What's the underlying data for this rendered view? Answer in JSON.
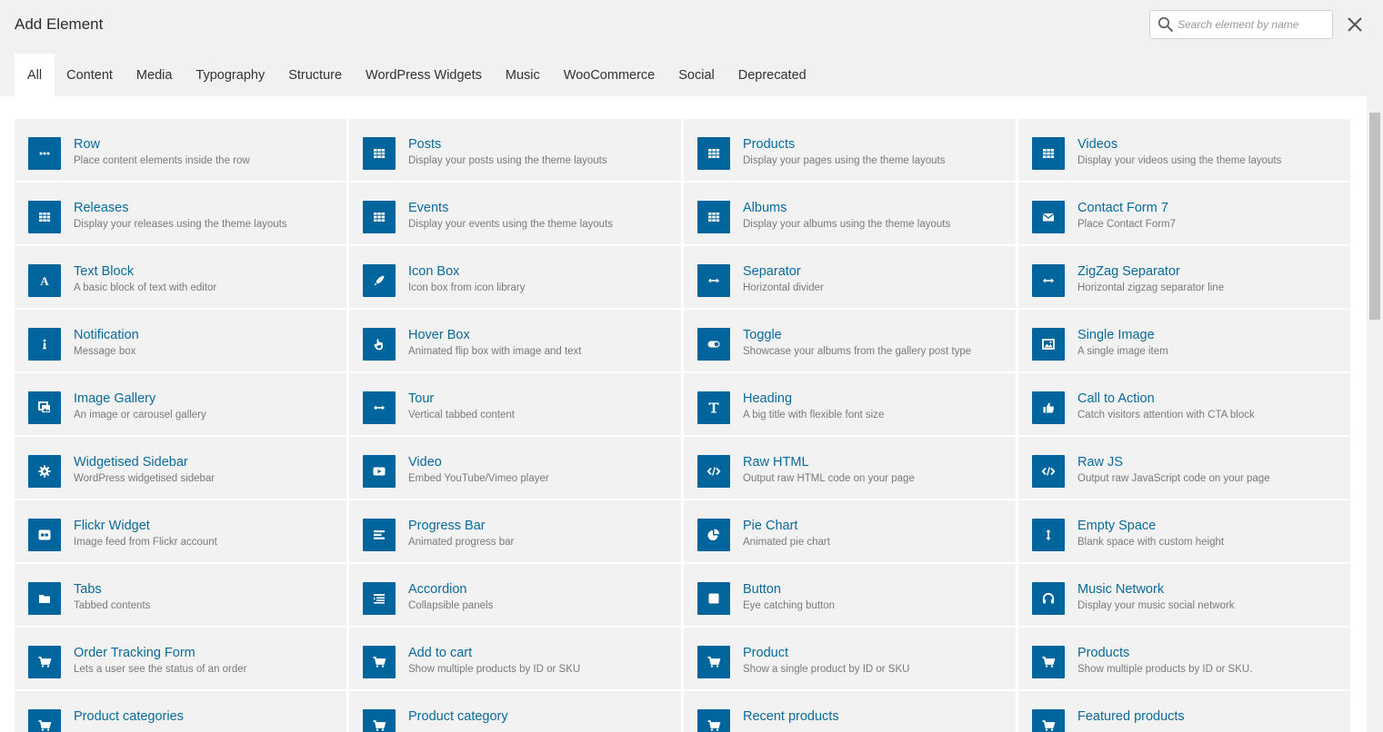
{
  "dialog": {
    "title": "Add Element",
    "search_placeholder": "Search element by name",
    "search_value": ""
  },
  "tabs": [
    {
      "label": "All",
      "active": true
    },
    {
      "label": "Content"
    },
    {
      "label": "Media"
    },
    {
      "label": "Typography"
    },
    {
      "label": "Structure"
    },
    {
      "label": "WordPress Widgets"
    },
    {
      "label": "Music"
    },
    {
      "label": "WooCommerce"
    },
    {
      "label": "Social"
    },
    {
      "label": "Deprecated"
    }
  ],
  "colors": {
    "accent": "#00659c",
    "link": "#0a6a9c"
  },
  "elements": [
    {
      "name": "Row",
      "desc": "Place content elements inside the row",
      "icon": "dots-icon"
    },
    {
      "name": "Posts",
      "desc": "Display your posts using the theme layouts",
      "icon": "grid-icon"
    },
    {
      "name": "Products",
      "desc": "Display your pages using the theme layouts",
      "icon": "grid-icon"
    },
    {
      "name": "Videos",
      "desc": "Display your videos using the theme layouts",
      "icon": "grid-icon"
    },
    {
      "name": "Releases",
      "desc": "Display your releases using the theme layouts",
      "icon": "grid-icon"
    },
    {
      "name": "Events",
      "desc": "Display your events using the theme layouts",
      "icon": "grid-icon"
    },
    {
      "name": "Albums",
      "desc": "Display your albums using the theme layouts",
      "icon": "grid-icon"
    },
    {
      "name": "Contact Form 7",
      "desc": "Place Contact Form7",
      "icon": "envelope-icon"
    },
    {
      "name": "Text Block",
      "desc": "A basic block of text with editor",
      "icon": "letter-a-icon"
    },
    {
      "name": "Icon Box",
      "desc": "Icon box from icon library",
      "icon": "rocket-icon"
    },
    {
      "name": "Separator",
      "desc": "Horizontal divider",
      "icon": "arrows-horizontal-icon"
    },
    {
      "name": "ZigZag Separator",
      "desc": "Horizontal zigzag separator line",
      "icon": "arrows-horizontal-icon"
    },
    {
      "name": "Notification",
      "desc": "Message box",
      "icon": "info-icon"
    },
    {
      "name": "Hover Box",
      "desc": "Animated flip box with image and text",
      "icon": "pointer-hand-icon"
    },
    {
      "name": "Toggle",
      "desc": "Showcase your albums from the gallery post type",
      "icon": "toggle-icon"
    },
    {
      "name": "Single Image",
      "desc": "A single image item",
      "icon": "picture-icon"
    },
    {
      "name": "Image Gallery",
      "desc": "An image or carousel gallery",
      "icon": "gallery-icon"
    },
    {
      "name": "Tour",
      "desc": "Vertical tabbed content",
      "icon": "arrows-horizontal-icon"
    },
    {
      "name": "Heading",
      "desc": "A big title with flexible font size",
      "icon": "heading-t-icon"
    },
    {
      "name": "Call to Action",
      "desc": "Catch visitors attention with CTA block",
      "icon": "thumbs-up-icon"
    },
    {
      "name": "Widgetised Sidebar",
      "desc": "WordPress widgetised sidebar",
      "icon": "gear-icon"
    },
    {
      "name": "Video",
      "desc": "Embed YouTube/Vimeo player",
      "icon": "video-play-icon"
    },
    {
      "name": "Raw HTML",
      "desc": "Output raw HTML code on your page",
      "icon": "code-icon"
    },
    {
      "name": "Raw JS",
      "desc": "Output raw JavaScript code on your page",
      "icon": "code-icon"
    },
    {
      "name": "Flickr Widget",
      "desc": "Image feed from Flickr account",
      "icon": "flickr-icon"
    },
    {
      "name": "Progress Bar",
      "desc": "Animated progress bar",
      "icon": "progress-bars-icon"
    },
    {
      "name": "Pie Chart",
      "desc": "Animated pie chart",
      "icon": "pie-chart-icon"
    },
    {
      "name": "Empty Space",
      "desc": "Blank space with custom height",
      "icon": "arrows-vertical-icon"
    },
    {
      "name": "Tabs",
      "desc": "Tabbed contents",
      "icon": "folder-icon"
    },
    {
      "name": "Accordion",
      "desc": "Collapsible panels",
      "icon": "accordion-list-icon"
    },
    {
      "name": "Button",
      "desc": "Eye catching button",
      "icon": "square-icon"
    },
    {
      "name": "Music Network",
      "desc": "Display your music social network",
      "icon": "headphones-icon"
    },
    {
      "name": "Order Tracking Form",
      "desc": "Lets a user see the status of an order",
      "icon": "cart-icon"
    },
    {
      "name": "Add to cart",
      "desc": "Show multiple products by ID or SKU",
      "icon": "cart-icon"
    },
    {
      "name": "Product",
      "desc": "Show a single product by ID or SKU",
      "icon": "cart-icon"
    },
    {
      "name": "Products",
      "desc": "Show multiple products by ID or SKU.",
      "icon": "cart-icon"
    },
    {
      "name": "Product categories",
      "desc": "",
      "icon": "cart-icon"
    },
    {
      "name": "Product category",
      "desc": "",
      "icon": "cart-icon"
    },
    {
      "name": "Recent products",
      "desc": "",
      "icon": "cart-icon"
    },
    {
      "name": "Featured products",
      "desc": "",
      "icon": "cart-icon"
    }
  ]
}
